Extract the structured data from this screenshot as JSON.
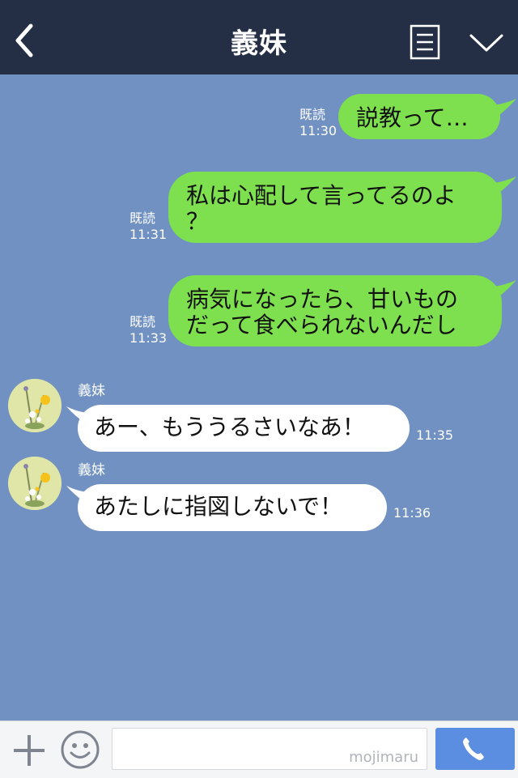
{
  "header": {
    "title": "義妹",
    "back_icon": "chevron-left-icon",
    "notes_icon": "notes-icon",
    "menu_icon": "chevron-down-icon"
  },
  "messages": [
    {
      "direction": "out",
      "read_label": "既読",
      "time": "11:30",
      "lines": [
        "説教って…"
      ]
    },
    {
      "direction": "out",
      "read_label": "既読",
      "time": "11:31",
      "lines": [
        "私は心配して言ってるのよ",
        "？"
      ]
    },
    {
      "direction": "out",
      "read_label": "既読",
      "time": "11:33",
      "lines": [
        "病気になったら、甘いもの",
        "だって食べられないんだし"
      ]
    },
    {
      "direction": "in",
      "sender": "義妹",
      "time": "11:35",
      "text": "あー、もううるさいなあ！"
    },
    {
      "direction": "in",
      "sender": "義妹",
      "time": "11:36",
      "text": "あたしに指図しないで！"
    }
  ],
  "input_bar": {
    "plus_icon": "plus-icon",
    "emoji_icon": "smiley-icon",
    "placeholder": "",
    "watermark": "mojimaru",
    "call_icon": "phone-icon"
  },
  "colors": {
    "header_bg": "#242e45",
    "chat_bg": "#7091c1",
    "outgoing_bubble": "#7ee04e",
    "incoming_bubble": "#ffffff",
    "call_button": "#5b8ee0"
  }
}
